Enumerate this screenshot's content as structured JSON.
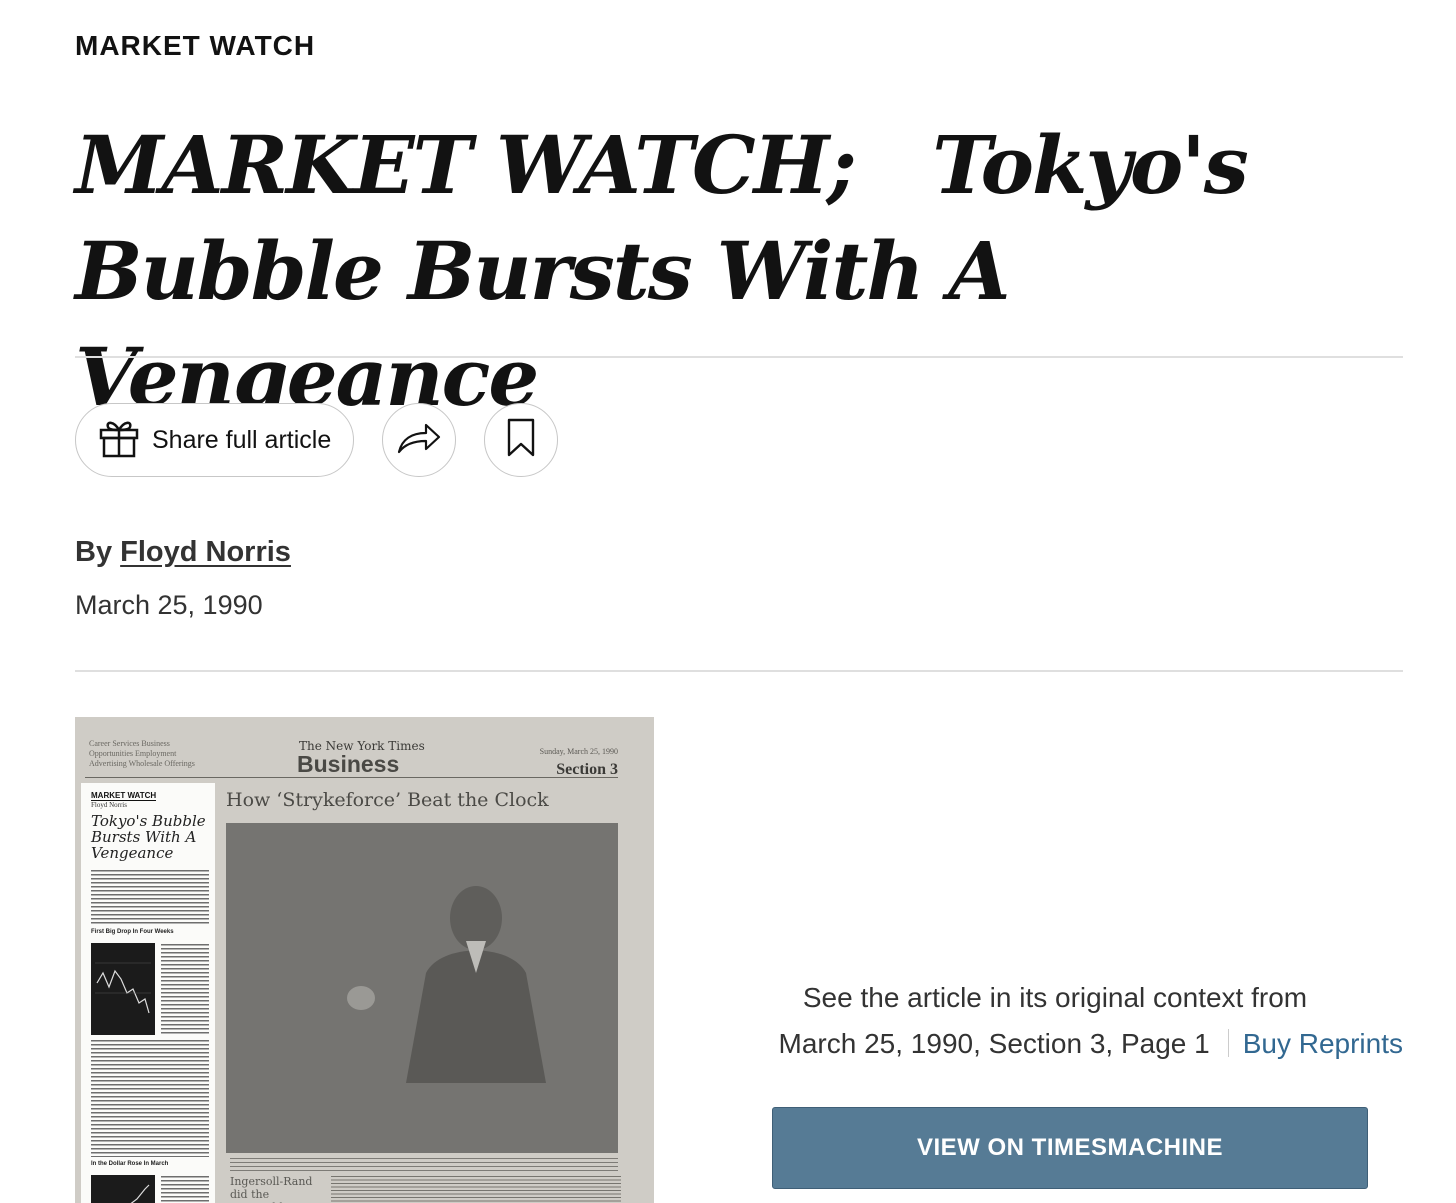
{
  "kicker": "MARKET WATCH",
  "headline": "MARKET WATCH;   Tokyo's Bubble Bursts With A Vengeance",
  "actions": {
    "share_full_article": "Share full article",
    "gift_icon": "gift-icon",
    "share_icon": "share-arrow-icon",
    "save_icon": "bookmark-icon"
  },
  "byline": {
    "prefix": "By",
    "author": "Floyd Norris"
  },
  "date": "March 25, 1990",
  "scan": {
    "mast_left": "Career Services Business Opportunities Employment Advertising Wholesale Offerings",
    "mast_logo": "The New York Times",
    "mast_section": "Business",
    "mast_date": "Sunday, March 25, 1990",
    "mast_section_no": "Section 3",
    "mw_kicker": "MARKET WATCH",
    "mw_author": "Floyd Norris",
    "mw_head": "Tokyo's Bubble Bursts With A Vengeance",
    "chart1_label": "First Big Drop In Four Weeks",
    "chart2_label": "In the Dollar Rose In March",
    "story_head": "How ‘Strykeforce’ Beat the Clock",
    "sub_head": "Ingersoll-Rand did the impossible: collapsed the design cycle to one year."
  },
  "context": {
    "line1": "See the article in its original context from",
    "line2": "March 25, 1990, Section 3, Page 1",
    "reprints": "Buy Reprints"
  },
  "timesmachine_button": "VIEW ON TIMESMACHINE",
  "colors": {
    "link": "#326891",
    "button_bg": "#567b95"
  }
}
